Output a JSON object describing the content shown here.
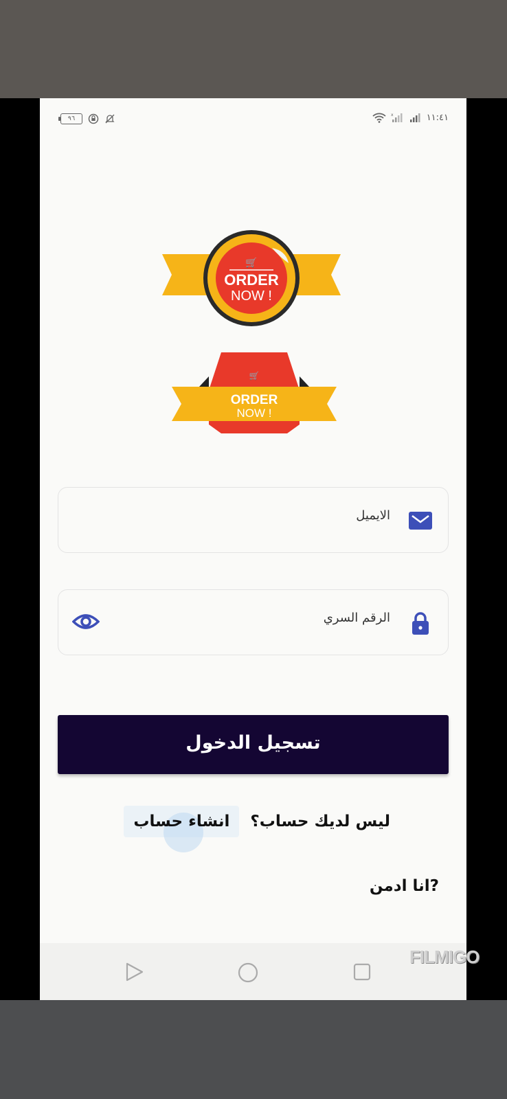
{
  "status_bar": {
    "battery": "٩٦",
    "time": "١١:٤١",
    "icons_left": [
      "battery-icon",
      "lock-circle-icon",
      "bell-off-icon"
    ],
    "icons_right": [
      "wifi-icon",
      "signal-icon",
      "signal-icon"
    ]
  },
  "badges": {
    "top": {
      "line1": "ORDER",
      "line2": "NOW !"
    },
    "bottom": {
      "line1": "ORDER",
      "line2": "NOW !"
    }
  },
  "form": {
    "email_label": "الايميل",
    "password_label": "الرقم السري",
    "login_button": "تسجيل الدخول",
    "signup_question": "ليس لديك حساب؟",
    "signup_link": "انشاء حساب",
    "admin_link": "?انا ادمن"
  },
  "colors": {
    "button_bg": "#140633",
    "icon_blue": "#3d4fb8",
    "badge_yellow": "#f6b418",
    "badge_red": "#e8392a"
  },
  "watermark": "FILMIGO"
}
